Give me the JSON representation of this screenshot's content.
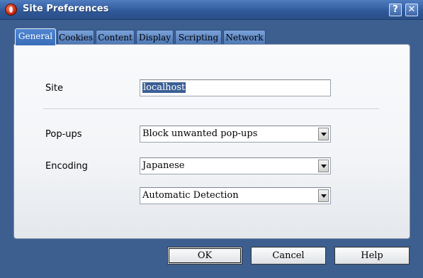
{
  "window": {
    "title": "Site Preferences",
    "help_glyph": "?",
    "close_glyph": "✕"
  },
  "tabs": [
    {
      "label": "General",
      "active": true
    },
    {
      "label": "Cookies",
      "active": false
    },
    {
      "label": "Content",
      "active": false
    },
    {
      "label": "Display",
      "active": false
    },
    {
      "label": "Scripting",
      "active": false
    },
    {
      "label": "Network",
      "active": false
    }
  ],
  "general": {
    "site_label": "Site",
    "site_value": "localhost",
    "popups_label": "Pop-ups",
    "popups_value": "Block unwanted pop-ups",
    "encoding_label": "Encoding",
    "encoding_value": "Japanese",
    "detection_value": "Automatic Detection"
  },
  "buttons": {
    "ok": "OK",
    "cancel": "Cancel",
    "help": "Help"
  },
  "colors": {
    "titlebar": "#2f5897",
    "active_tab": "#3a6db8",
    "selection": "#3b5f95"
  }
}
